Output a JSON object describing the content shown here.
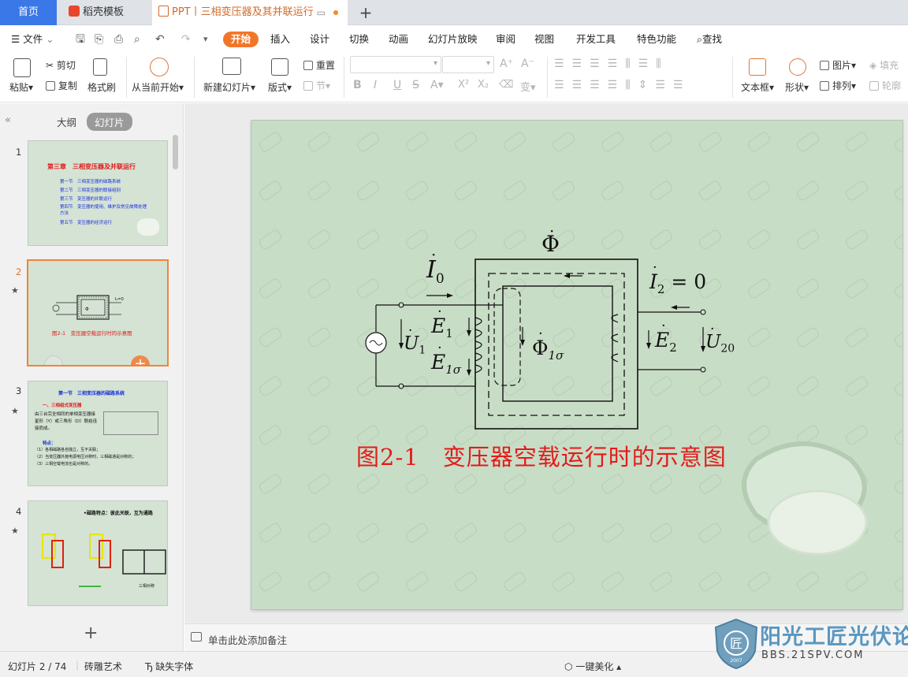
{
  "tabs": {
    "home": "首页",
    "templates": "稻壳模板",
    "document": "PPT丨三相变压器及其并联运行"
  },
  "menu": {
    "file": "文件",
    "items": [
      "开始",
      "插入",
      "设计",
      "切换",
      "动画",
      "幻灯片放映",
      "审阅",
      "视图",
      "开发工具",
      "特色功能"
    ],
    "search": "查找"
  },
  "ribbon": {
    "paste": "粘贴",
    "cut": "剪切",
    "copy": "复制",
    "format_painter": "格式刷",
    "from_current": "从当前开始",
    "new_slide": "新建幻灯片",
    "layout": "版式",
    "reset": "重置",
    "section": "节",
    "text_box": "文本框",
    "shape": "形状",
    "picture": "图片",
    "arrange": "排列",
    "fill": "填充",
    "outline": "轮廓"
  },
  "left_panel": {
    "outline_tab": "大纲",
    "slides_tab": "幻灯片",
    "slide_numbers": [
      "1",
      "2",
      "3",
      "4"
    ]
  },
  "thumbs": {
    "t1_title": "第三章　三相变压器及并联运行",
    "t1_items": [
      "第一节　三相变压器的磁路系统",
      "第二节　三相变压器的联接组别",
      "第三节　变压器的并联运行",
      "第四节　变压器的使用、维护及常见故障处理方法",
      "第五节　变压器的经济运行"
    ],
    "t2_caption": "图2-1　变压器空载运行时的示意图",
    "t3_title": "第一节　三相变压器的磁路系统",
    "t3_sub": "一、三相组式变压器",
    "t3_body": "由三台完全相同的单相变压器接星形（Y）或三角形（D）联结连接而成。",
    "t3_feature": "特点：",
    "t3_points": [
      "（1）各相磁路各自独立，互不关联；",
      "（2）当变压器外施电源电压对称时，三相磁通是对称的；",
      "（3）三相空载电流也是对称的。"
    ],
    "t4_title": "•磁路特点：彼此关联，互为通路",
    "t4_eq": "三相对称"
  },
  "slide": {
    "caption": "图2-1　变压器空载运行时的示意图",
    "phi": "Φ",
    "i0": "I",
    "i0_sub": "0",
    "i2": "I",
    "i2_sub": "2",
    "i2_rest": " = 0",
    "e1": "E",
    "e1_sub": "1",
    "u1": "U",
    "u1_sub": "1",
    "e1s": "E",
    "e1s_sub": "1σ",
    "phi1s": "Φ",
    "phi1s_sub": "1σ",
    "e2": "E",
    "e2_sub": "2",
    "u20": "U",
    "u20_sub": "20"
  },
  "notes": "单击此处添加备注",
  "status": {
    "slide_pos": "幻灯片 2 / 74",
    "theme": "砖雕艺术",
    "missing_font": "缺失字体",
    "beautify": "一键美化"
  },
  "watermark": {
    "brand": "阳光工匠光伏论坛",
    "url": "BBS.21SPV.COM",
    "badge": "匠",
    "year": "2007"
  },
  "colors": {
    "accent": "#f2762a",
    "home_tab": "#3b78e7",
    "slide_bg": "#c8ddc6",
    "caption_red": "#e31b1b"
  }
}
